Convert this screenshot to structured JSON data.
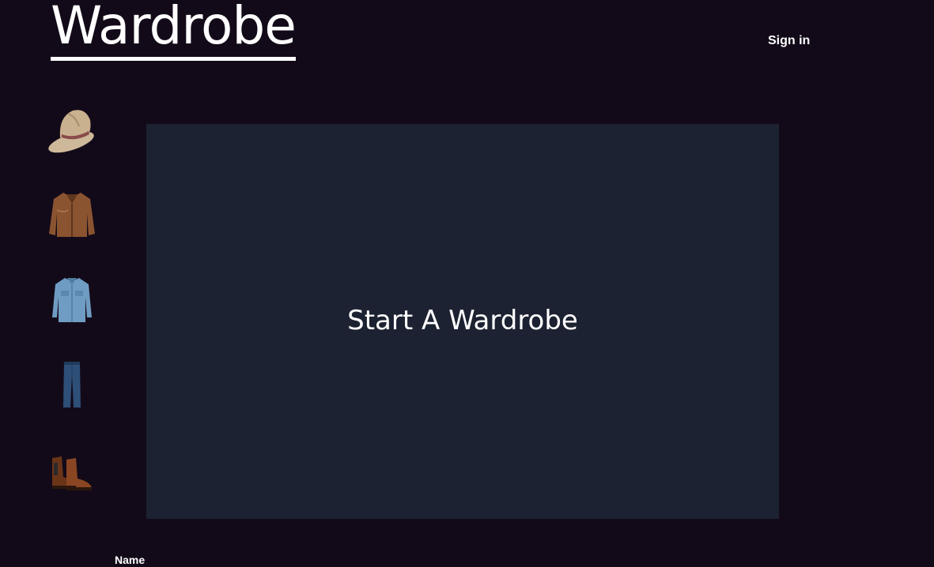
{
  "header": {
    "logo_text": "Wardrobe",
    "signin_label": "Sign in"
  },
  "sidebar": {
    "items": [
      {
        "icon": "hat-icon"
      },
      {
        "icon": "leather-jacket-icon"
      },
      {
        "icon": "denim-shirt-icon"
      },
      {
        "icon": "jeans-icon"
      },
      {
        "icon": "boots-icon"
      }
    ]
  },
  "main": {
    "stage_title": "Start A Wardrobe"
  },
  "form": {
    "name_label": "Name"
  },
  "colors": {
    "background": "#130a19",
    "stage": "#1c2231",
    "text": "#ffffff"
  }
}
